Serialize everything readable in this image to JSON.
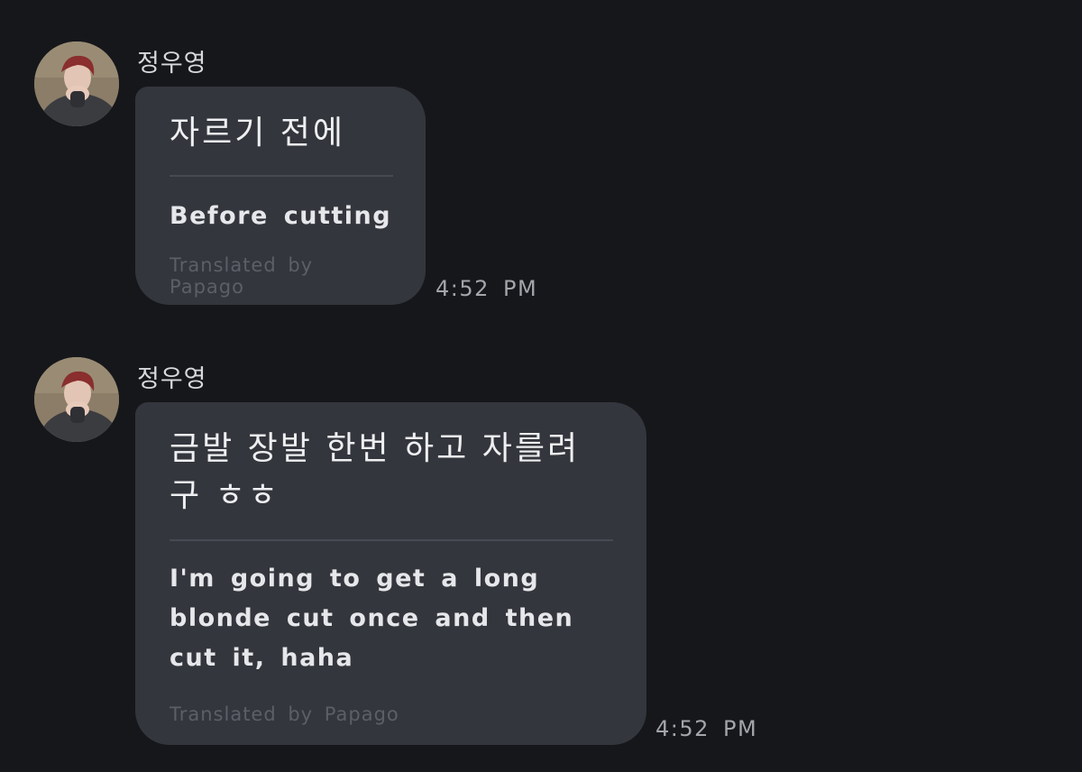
{
  "theme": {
    "background": "#16171b",
    "bubble": "#34363d",
    "divider": "#474a52",
    "text_primary": "#eeeff1",
    "text_muted": "#5c5f67",
    "timestamp": "#a3a5ab"
  },
  "messages": [
    {
      "sender": "정우영",
      "avatar_icon": "profile-photo-icon",
      "original": "자르기 전에",
      "translated": "Before cutting",
      "credit": "Translated by Papago",
      "time": "4:52 PM"
    },
    {
      "sender": "정우영",
      "avatar_icon": "profile-photo-icon",
      "original": "금발 장발 한번 하고 자를려\n구 ㅎㅎ",
      "translated": "I'm going to get a long blonde cut once and then cut it, haha",
      "credit": "Translated by Papago",
      "time": "4:52 PM"
    }
  ]
}
